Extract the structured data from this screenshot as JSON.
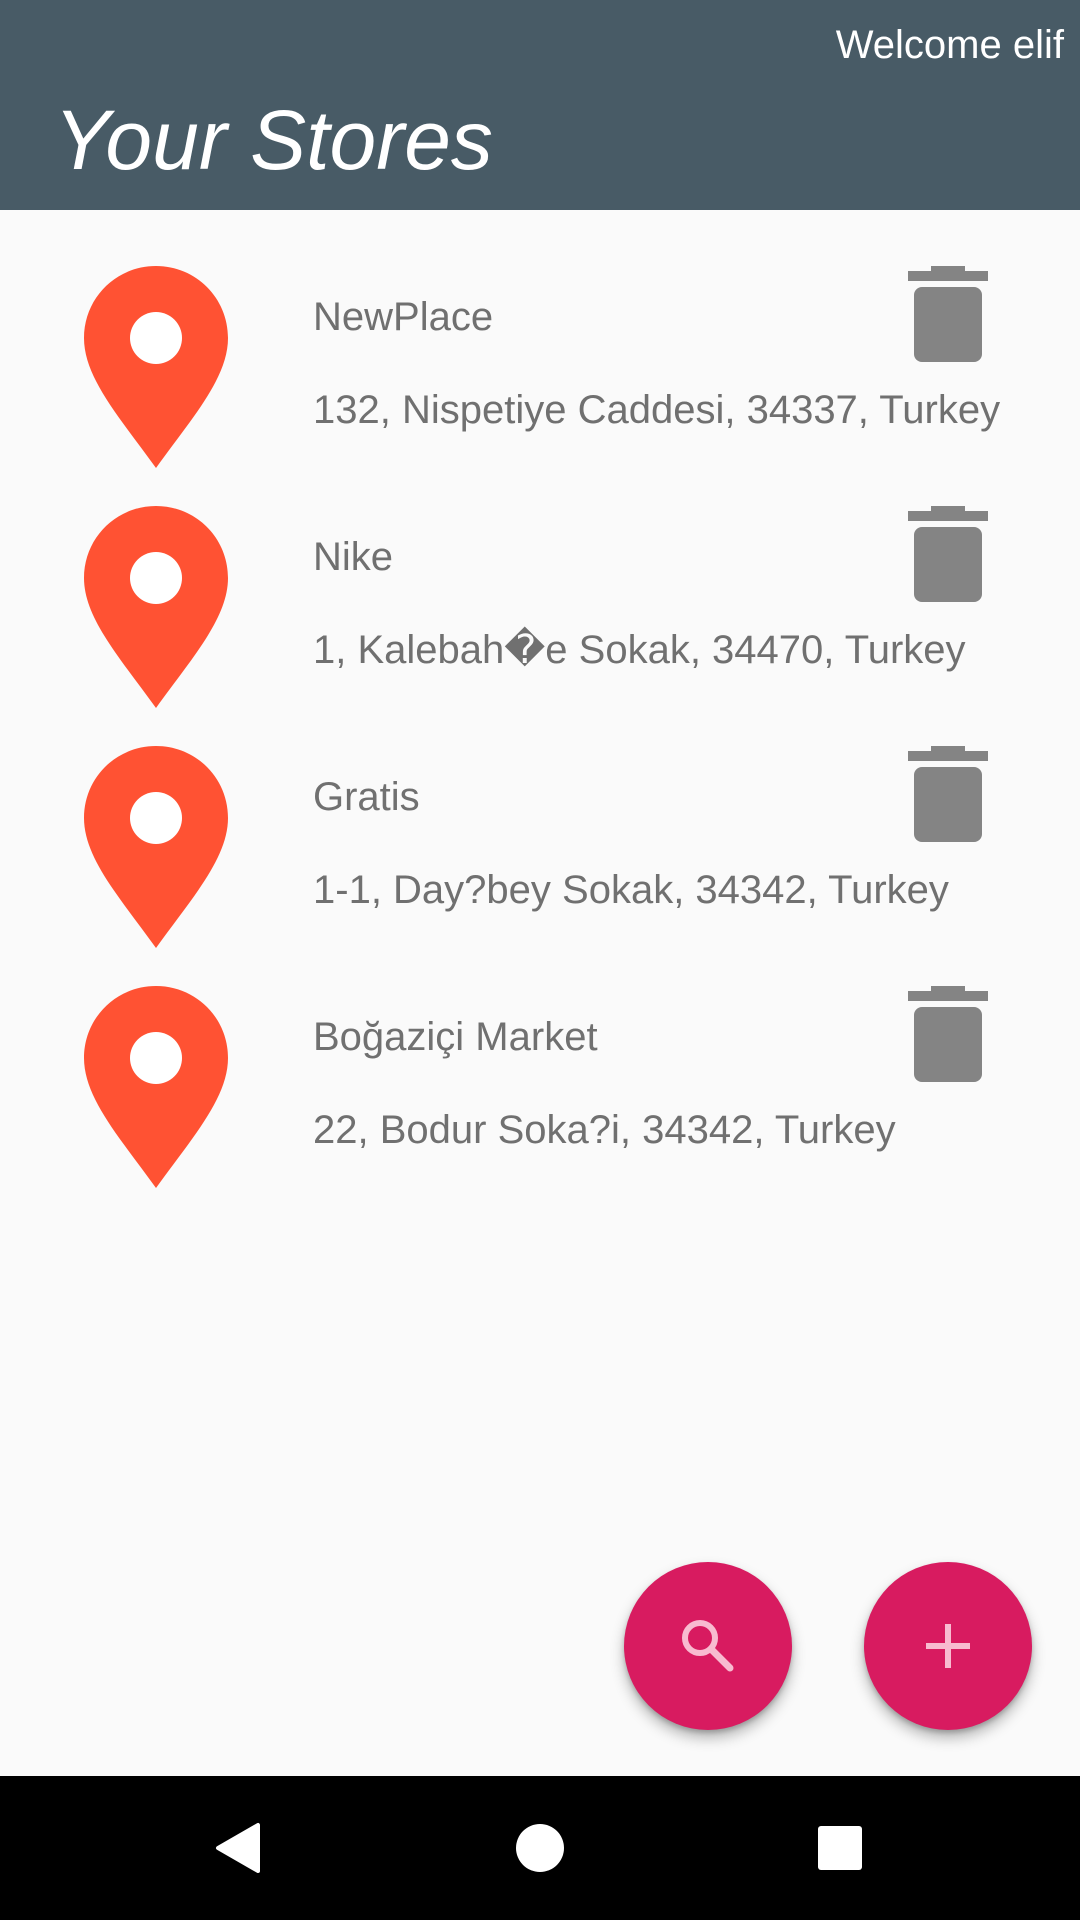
{
  "header": {
    "welcome": "Welcome elif",
    "title": "Your Stores"
  },
  "stores": [
    {
      "name": "NewPlace",
      "address": "132, Nispetiye Caddesi, 34337, Turkey"
    },
    {
      "name": "Nike",
      "address": "1, Kalebah�e Sokak, 34470, Turkey"
    },
    {
      "name": "Gratis",
      "address": "1-1, Day?bey Sokak, 34342, Turkey"
    },
    {
      "name": "Boğaziçi Market",
      "address": "22, Bodur Soka?i, 34342, Turkey"
    }
  ],
  "icons": {
    "store_pin": "map-pin-icon",
    "delete": "trash-icon",
    "search_fab": "search-icon",
    "add_fab": "plus-icon",
    "nav_back": "back-triangle-icon",
    "nav_home": "home-circle-icon",
    "nav_recents": "recents-square-icon"
  },
  "colors": {
    "app_bar": "#485b66",
    "pin": "#ff5233",
    "fab": "#d81b60",
    "trash": "#848484",
    "text": "#707070",
    "background": "#fafafa"
  }
}
